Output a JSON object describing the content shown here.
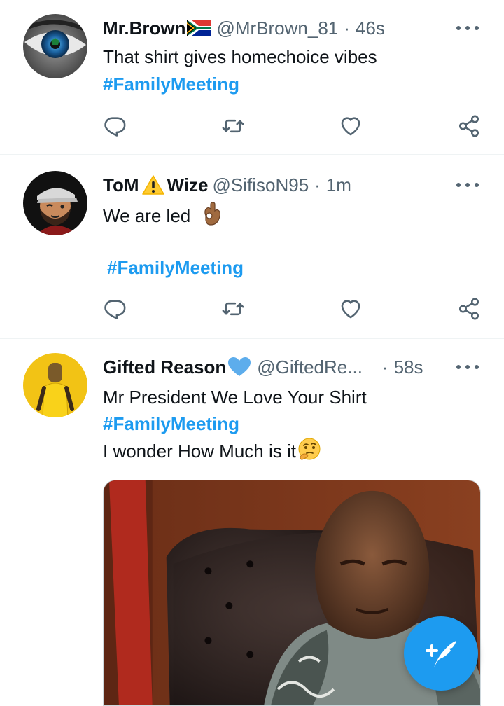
{
  "tweets": [
    {
      "name": "Mr.Brown",
      "handle": "@MrBrown_81",
      "separator": "·",
      "time": "46s",
      "text": "That shirt gives homechoice vibes",
      "hashtag": "#FamilyMeeting",
      "badge": "south-africa-flag-icon"
    },
    {
      "name_part1": "ToM",
      "name_part2": "Wize",
      "handle": "@SifisoN95",
      "separator": "·",
      "time": "1m",
      "text": "We are led",
      "hashtag": "#FamilyMeeting",
      "badge": "warning-sign-icon",
      "emoji": "ok-hand-emoji"
    },
    {
      "name": "Gifted Reason",
      "handle": "@GiftedRe...",
      "separator": "·",
      "time": "58s",
      "text": "Mr President We Love Your Shirt",
      "hashtag": "#FamilyMeeting",
      "text2": "I wonder How Much is it",
      "badge": "blue-heart-icon",
      "emoji": "thinking-face-emoji",
      "media": "photo-man-in-patterned-shirt-on-leather-chair"
    }
  ],
  "actions": [
    "reply-icon",
    "retweet-icon",
    "like-icon",
    "share-icon"
  ],
  "compose_button": "compose-tweet-icon",
  "colors": {
    "accent": "#1d9bf0",
    "text": "#0f1419",
    "secondary": "#536471",
    "divider": "#eff3f4"
  }
}
